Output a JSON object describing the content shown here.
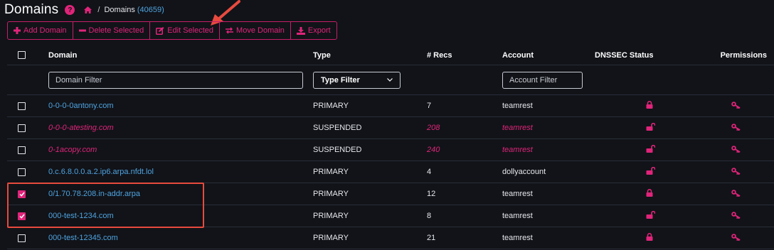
{
  "header": {
    "title": "Domains",
    "breadcrumb_sep": "/",
    "breadcrumb_label": "Domains",
    "breadcrumb_count": "(40659)"
  },
  "toolbar": {
    "add": "Add Domain",
    "delete": "Delete Selected",
    "edit": "Edit Selected",
    "move": "Move Domain",
    "export": "Export"
  },
  "columns": {
    "domain": "Domain",
    "type": "Type",
    "recs": "# Recs",
    "account": "Account",
    "dnssec": "DNSSEC Status",
    "permissions": "Permissions"
  },
  "filters": {
    "domain_placeholder": "Domain Filter",
    "type_value": "Type Filter",
    "account_placeholder": "Account Filter"
  },
  "rows": [
    {
      "domain": "0-0-0-0antony.com",
      "type": "PRIMARY",
      "recs": "7",
      "account": "teamrest",
      "checked": false,
      "suspended": false,
      "dnssec": "locked"
    },
    {
      "domain": "0-0-0-atesting.com",
      "type": "SUSPENDED",
      "recs": "208",
      "account": "teamrest",
      "checked": false,
      "suspended": true,
      "dnssec": "unlocked"
    },
    {
      "domain": "0-1acopy.com",
      "type": "SUSPENDED",
      "recs": "240",
      "account": "teamrest",
      "checked": false,
      "suspended": true,
      "dnssec": "unlocked"
    },
    {
      "domain": "0.c.6.8.0.0.a.2.ip6.arpa.nfdt.lol",
      "type": "PRIMARY",
      "recs": "4",
      "account": "dollyaccount",
      "checked": false,
      "suspended": false,
      "dnssec": "unlocked"
    },
    {
      "domain": "0/1.70.78.208.in-addr.arpa",
      "type": "PRIMARY",
      "recs": "12",
      "account": "teamrest",
      "checked": true,
      "suspended": false,
      "dnssec": "locked"
    },
    {
      "domain": "000-test-1234.com",
      "type": "PRIMARY",
      "recs": "8",
      "account": "teamrest",
      "checked": true,
      "suspended": false,
      "dnssec": "unlocked"
    },
    {
      "domain": "000-test-12345.com",
      "type": "PRIMARY",
      "recs": "21",
      "account": "teamrest",
      "checked": false,
      "suspended": false,
      "dnssec": "locked"
    }
  ],
  "colors": {
    "accent": "#e0247a",
    "link": "#4fa3e0",
    "background": "#111318",
    "annotation": "#e84a3e"
  }
}
